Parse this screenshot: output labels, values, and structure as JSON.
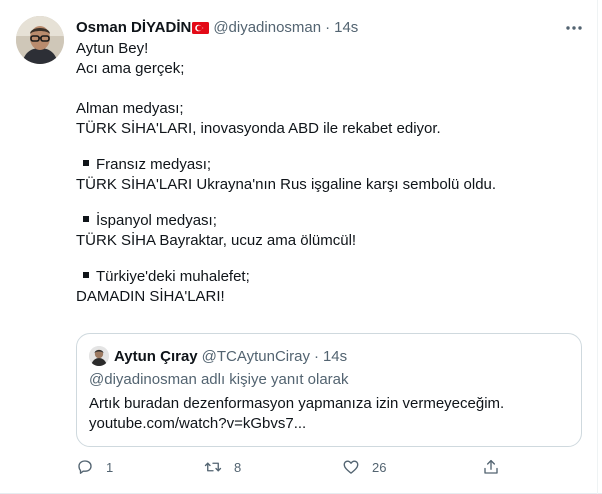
{
  "author": {
    "name": "Osman DİYADİN",
    "handle": "@diyadinosman",
    "separator": "·",
    "time": "14s"
  },
  "colors": {
    "text": "#0f1419",
    "secondary": "#536471",
    "border": "#cfd9de",
    "flag_red": "#e30a17"
  },
  "tweet": {
    "lines": [
      "Aytun Bey!",
      "Acı ama gerçek;",
      "",
      "Alman medyası;",
      "TÜRK SİHA'LARI, inovasyonda ABD ile rekabet ediyor.",
      "",
      "Fransız medyası;",
      "TÜRK SİHA'LARI Ukrayna'nın Rus işgaline karşı sembolü oldu.",
      "",
      "İspanyol medyası;",
      "TÜRK SİHA Bayraktar, ucuz ama ölümcül!",
      "",
      "Türkiye'deki muhalefet;",
      "DAMADIN SİHA'LARI!"
    ]
  },
  "quote": {
    "name": "Aytun Çıray",
    "handle": "@TCAytunCiray",
    "separator": "·",
    "time": "14s",
    "reply_to": "@diyadinosman adlı kişiye yanıt olarak",
    "text_line1": "Artık buradan dezenformasyon yapmanıza izin vermeyeceğim.",
    "text_line2": "youtube.com/watch?v=kGbvs7..."
  },
  "actions": {
    "reply_count": "1",
    "retweet_count": "8",
    "like_count": "26",
    "icons": [
      "reply-icon",
      "retweet-icon",
      "like-icon",
      "share-icon"
    ]
  }
}
